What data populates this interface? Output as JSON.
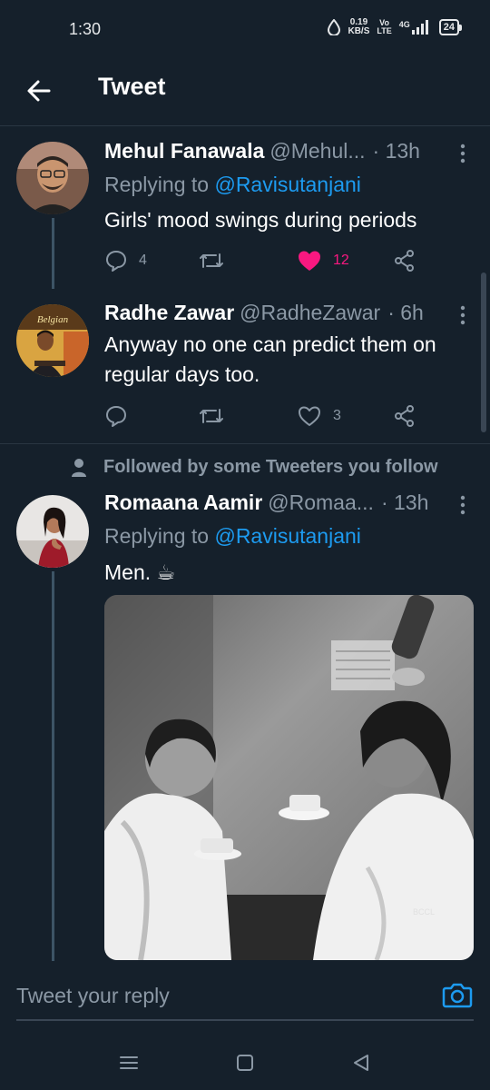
{
  "status_bar": {
    "time": "1:30",
    "speed_value": "0.19",
    "speed_unit": "KB/S",
    "network_vo": "Vo",
    "network_lte": "LTE",
    "network_type": "4G",
    "battery": "24"
  },
  "header": {
    "title": "Tweet"
  },
  "tweets": [
    {
      "name": "Mehul Fanawala",
      "handle": "@Mehul...",
      "time": "· 13h",
      "replying_prefix": "Replying to ",
      "replying_to": "@Ravisutanjani",
      "text": "Girls' mood swings during periods",
      "replies": "4",
      "likes": "12",
      "liked": true
    },
    {
      "name": "Radhe Zawar",
      "handle": "@RadheZawar",
      "time": "· 6h",
      "text": "Anyway no one can predict them on regular days too.",
      "likes": "3",
      "avatar_sign": "Belgian"
    },
    {
      "social_context": "Followed by some Tweeters you follow",
      "name": "Romaana Aamir",
      "handle": "@Romaa...",
      "time": "· 13h",
      "replying_prefix": "Replying to ",
      "replying_to": "@Ravisutanjani",
      "text": "Men. ☕",
      "image_watermark": "BCCL"
    }
  ],
  "reply_bar": {
    "placeholder": "Tweet your reply"
  },
  "colors": {
    "background": "#15202b",
    "accent": "#1d9bf0",
    "like": "#f91880",
    "muted": "#8b98a5"
  },
  "icons": {
    "back": "arrow-left-icon",
    "more": "more-vertical-icon",
    "reply": "reply-icon",
    "retweet": "retweet-icon",
    "like": "heart-icon",
    "share": "share-icon",
    "camera": "camera-icon",
    "person": "person-icon"
  }
}
